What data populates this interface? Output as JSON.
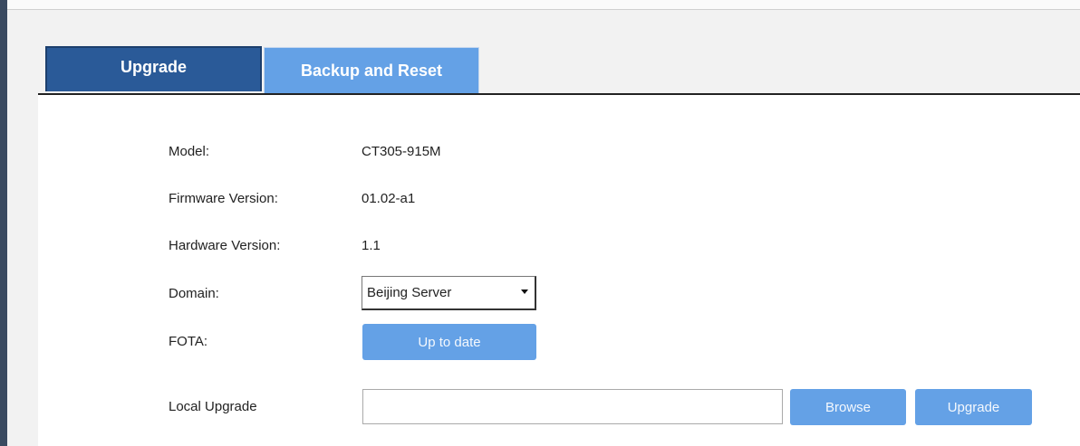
{
  "tabs": [
    {
      "label": "Upgrade",
      "active": true
    },
    {
      "label": "Backup and Reset",
      "active": false
    }
  ],
  "fields": {
    "model": {
      "label": "Model:",
      "value": "CT305-915M"
    },
    "firmware": {
      "label": "Firmware Version:",
      "value": "01.02-a1"
    },
    "hardware": {
      "label": "Hardware Version:",
      "value": "1.1"
    },
    "domain": {
      "label": "Domain:",
      "selected": "Beijing Server"
    },
    "fota": {
      "label": "FOTA:",
      "button": "Up to date"
    },
    "local_upgrade": {
      "label": "Local Upgrade",
      "file_value": "",
      "browse": "Browse",
      "upgrade": "Upgrade"
    }
  },
  "colors": {
    "active_tab": "#2a5a98",
    "inactive_tab": "#64a1e6",
    "button": "#64a1e6",
    "sidebar_edge": "#3a4a60"
  },
  "icons": {
    "domain_dropdown": "chevron-down-icon"
  }
}
